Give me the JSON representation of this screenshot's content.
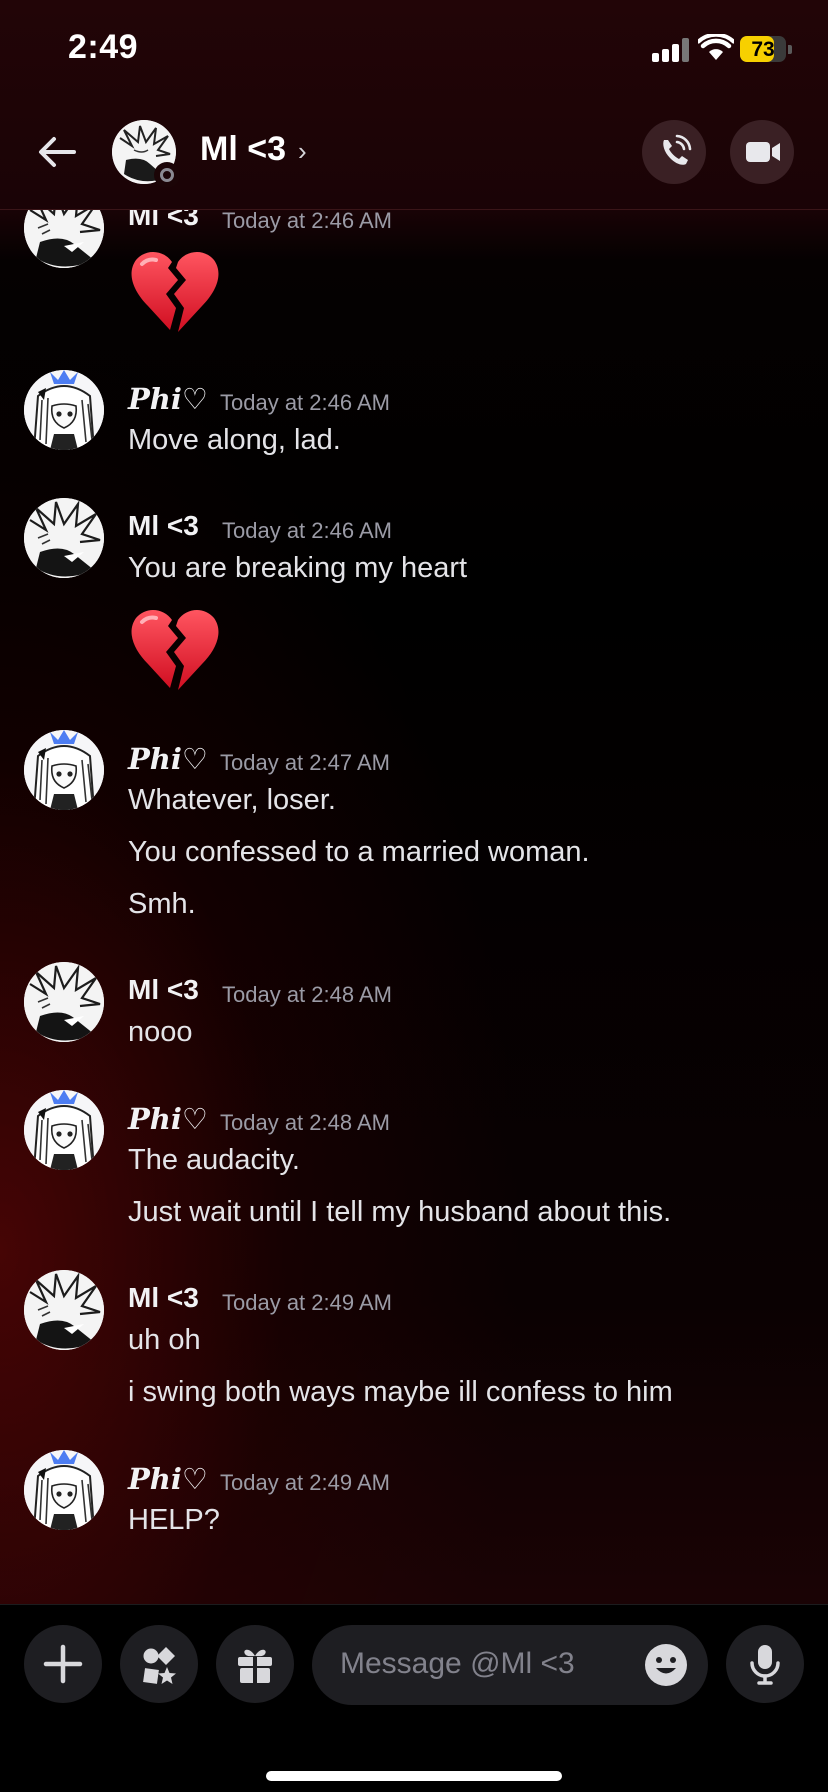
{
  "status_bar": {
    "time": "2:49",
    "battery": "73",
    "battery_level": 0.73
  },
  "header": {
    "name": "Ml <3",
    "chevron": "›"
  },
  "messages": [
    {
      "author": "Ml <3",
      "timestamp": "Today at 2:46 AM",
      "lines": [],
      "emoji": "broken-heart"
    },
    {
      "author": "Phi♡",
      "timestamp": "Today at 2:46 AM",
      "lines": [
        "Move along, lad."
      ]
    },
    {
      "author": "Ml <3",
      "timestamp": "Today at 2:46 AM",
      "lines": [
        "You are breaking my heart"
      ],
      "emoji": "broken-heart"
    },
    {
      "author": "Phi♡",
      "timestamp": "Today at 2:47 AM",
      "lines": [
        "Whatever, loser.",
        "You confessed to a married woman.",
        "Smh."
      ]
    },
    {
      "author": "Ml <3",
      "timestamp": "Today at 2:48 AM",
      "lines": [
        "nooo"
      ]
    },
    {
      "author": "Phi♡",
      "timestamp": "Today at 2:48 AM",
      "lines": [
        "The audacity.",
        "Just wait until I tell my husband about this."
      ]
    },
    {
      "author": "Ml <3",
      "timestamp": "Today at 2:49 AM",
      "lines": [
        "uh oh",
        "i swing both ways maybe ill confess to him"
      ]
    },
    {
      "author": "Phi♡",
      "timestamp": "Today at 2:49 AM",
      "lines": [
        "HELP?"
      ]
    }
  ],
  "composer": {
    "placeholder": "Message @Ml <3"
  },
  "icons": [
    "back-arrow-icon",
    "phone-call-icon",
    "video-camera-icon",
    "plus-icon",
    "apps-icon",
    "gift-icon",
    "emoji-icon",
    "microphone-icon"
  ]
}
